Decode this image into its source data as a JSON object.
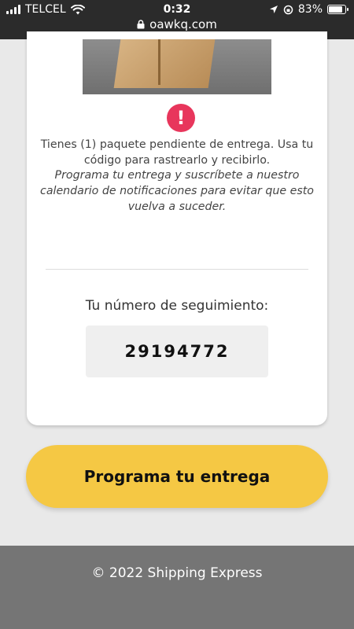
{
  "status_bar": {
    "carrier": "TELCEL",
    "time": "0:32",
    "url": "oawkq.com",
    "battery_percent": "83%",
    "battery_level": 0.83
  },
  "card": {
    "notice_text": "Tienes (1) paquete pendiente de entrega. Usa tu código para rastrearlo y recibirlo.",
    "notice_italic": "Programa tu entrega y suscríbete a nuestro calendario de notificaciones para evitar que esto vuelva a suceder.",
    "tracking_label": "Tu número de seguimiento:",
    "tracking_number": "29194772"
  },
  "cta": {
    "label": "Programa tu entrega"
  },
  "footer": {
    "text": "© 2022 Shipping Express"
  },
  "colors": {
    "accent": "#f5c844",
    "alert": "#e8365c",
    "footer_bg": "#757575",
    "status_bg": "#2b2b2b"
  },
  "icons": [
    "signal-icon",
    "wifi-icon",
    "lock-icon",
    "location-arrow-icon",
    "orientation-lock-icon",
    "battery-icon",
    "alert-icon"
  ]
}
